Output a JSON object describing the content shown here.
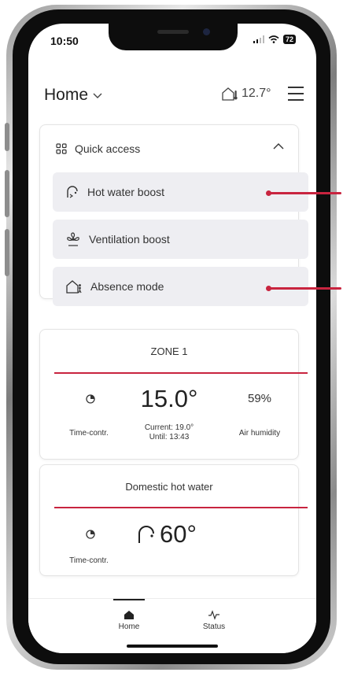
{
  "status_bar": {
    "time": "10:50",
    "battery": "72"
  },
  "header": {
    "title": "Home",
    "outdoor_temp": "12.7°"
  },
  "quick_access": {
    "title": "Quick access",
    "items": [
      {
        "label": "Hot water boost",
        "icon": "hot-water-icon"
      },
      {
        "label": "Ventilation boost",
        "icon": "fan-icon"
      },
      {
        "label": "Absence mode",
        "icon": "house-person-icon"
      }
    ]
  },
  "zone": {
    "title": "ZONE 1",
    "mode_label": "Time-contr.",
    "setpoint": "15.0°",
    "current": "Current: 19.0°",
    "until": "Until: 13:43",
    "humidity": "59%",
    "humidity_label": "Air humidity"
  },
  "dhw": {
    "title": "Domestic hot water",
    "mode_label": "Time-contr.",
    "setpoint": "60°"
  },
  "nav": {
    "home_label": "Home",
    "status_label": "Status"
  },
  "colors": {
    "accent": "#c8243f",
    "card_item_bg": "#eeeef2"
  }
}
